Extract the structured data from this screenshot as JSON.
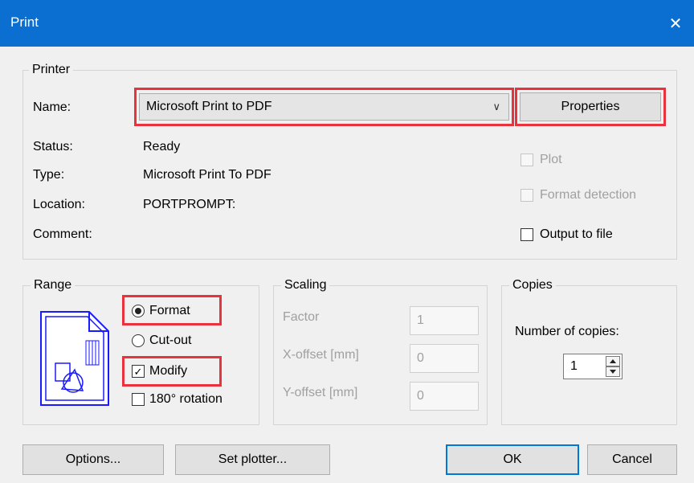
{
  "window": {
    "title": "Print"
  },
  "printer": {
    "legend": "Printer",
    "name_label": "Name:",
    "name_value": "Microsoft Print to PDF",
    "properties_label": "Properties",
    "status_label": "Status:",
    "status_value": "Ready",
    "type_label": "Type:",
    "type_value": "Microsoft Print To PDF",
    "location_label": "Location:",
    "location_value": "PORTPROMPT:",
    "comment_label": "Comment:",
    "comment_value": "",
    "plot_label": "Plot",
    "plot_checked": false,
    "format_detection_label": "Format detection",
    "format_detection_checked": false,
    "output_to_file_label": "Output to file",
    "output_to_file_checked": false
  },
  "range": {
    "legend": "Range",
    "format_label": "Format",
    "cutout_label": "Cut-out",
    "selected": "Format",
    "modify_label": "Modify",
    "modify_checked": true,
    "rotation_label": "180° rotation",
    "rotation_checked": false
  },
  "scaling": {
    "legend": "Scaling",
    "factor_label": "Factor",
    "factor_value": "1",
    "xoffset_label": "X-offset [mm]",
    "xoffset_value": "0",
    "yoffset_label": "Y-offset [mm]",
    "yoffset_value": "0"
  },
  "copies": {
    "legend": "Copies",
    "number_label": "Number of copies:",
    "number_value": "1"
  },
  "buttons": {
    "options": "Options...",
    "set_plotter": "Set plotter...",
    "ok": "OK",
    "cancel": "Cancel"
  },
  "colors": {
    "titlebar": "#0a6fd0",
    "highlight": "#e8333f",
    "preview_blue": "#1a1aff"
  },
  "icons": {
    "close": "close-icon",
    "dropdown": "chevron-down-icon",
    "range_preview": "page-format-preview-icon"
  }
}
